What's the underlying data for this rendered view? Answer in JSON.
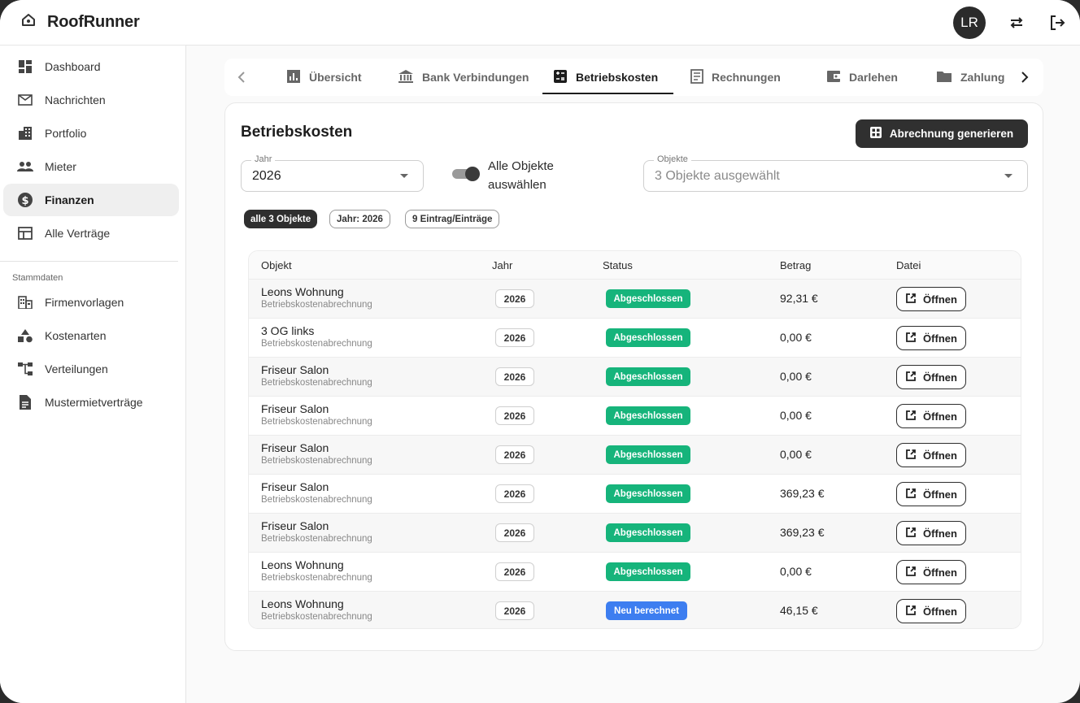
{
  "app": {
    "title": "RoofRunner",
    "logo_icon": "house-icon"
  },
  "header": {
    "avatar_initials": "LR",
    "switch_icon": "swap-arrows-icon",
    "logout_icon": "logout-icon"
  },
  "sidebar": {
    "items": [
      {
        "label": "Dashboard",
        "icon": "dashboard-icon"
      },
      {
        "label": "Nachrichten",
        "icon": "mail-icon"
      },
      {
        "label": "Portfolio",
        "icon": "building-icon"
      },
      {
        "label": "Mieter",
        "icon": "people-icon"
      },
      {
        "label": "Finanzen",
        "icon": "dollar-circle-icon",
        "active": true
      },
      {
        "label": "Alle Verträge",
        "icon": "table-icon"
      }
    ],
    "section_title": "Stammdaten",
    "section_items": [
      {
        "label": "Firmenvorlagen",
        "icon": "company-icon"
      },
      {
        "label": "Kostenarten",
        "icon": "shapes-icon"
      },
      {
        "label": "Verteilungen",
        "icon": "tree-icon"
      },
      {
        "label": "Mustermietverträge",
        "icon": "document-icon"
      }
    ]
  },
  "tabs": [
    {
      "label": "Übersicht",
      "icon": "chart-icon"
    },
    {
      "label": "Bank Verbindungen",
      "icon": "bank-icon"
    },
    {
      "label": "Betriebskosten",
      "icon": "calculator-icon",
      "active": true
    },
    {
      "label": "Rechnungen",
      "icon": "receipt-icon"
    },
    {
      "label": "Darlehen",
      "icon": "wallet-icon"
    },
    {
      "label": "Zahlung",
      "icon": "folder-icon"
    }
  ],
  "main": {
    "title": "Betriebskosten",
    "generate_button": "Abrechnung generieren",
    "year_field": {
      "label": "Jahr",
      "value": "2026"
    },
    "toggle_label": "Alle Objekte auswählen",
    "toggle_on": true,
    "objects_field": {
      "label": "Objekte",
      "value": "3 Objekte ausgewählt"
    },
    "chips": [
      "alle 3 Objekte",
      "Jahr: 2026",
      "9 Eintrag/Einträge"
    ]
  },
  "table": {
    "headers": [
      "Objekt",
      "Jahr",
      "Status",
      "Betrag",
      "Datei"
    ],
    "open_label": "Öffnen",
    "rows": [
      {
        "name": "Leons Wohnung",
        "sub": "Betriebskostenabrechnung",
        "year": "2026",
        "status": "Abgeschlossen",
        "status_type": "done",
        "amount": "92,31 €"
      },
      {
        "name": "3 OG links",
        "sub": "Betriebskostenabrechnung",
        "year": "2026",
        "status": "Abgeschlossen",
        "status_type": "done",
        "amount": "0,00 €"
      },
      {
        "name": "Friseur Salon",
        "sub": "Betriebskostenabrechnung",
        "year": "2026",
        "status": "Abgeschlossen",
        "status_type": "done",
        "amount": "0,00 €"
      },
      {
        "name": "Friseur Salon",
        "sub": "Betriebskostenabrechnung",
        "year": "2026",
        "status": "Abgeschlossen",
        "status_type": "done",
        "amount": "0,00 €"
      },
      {
        "name": "Friseur Salon",
        "sub": "Betriebskostenabrechnung",
        "year": "2026",
        "status": "Abgeschlossen",
        "status_type": "done",
        "amount": "0,00 €"
      },
      {
        "name": "Friseur Salon",
        "sub": "Betriebskostenabrechnung",
        "year": "2026",
        "status": "Abgeschlossen",
        "status_type": "done",
        "amount": "369,23 €"
      },
      {
        "name": "Friseur Salon",
        "sub": "Betriebskostenabrechnung",
        "year": "2026",
        "status": "Abgeschlossen",
        "status_type": "done",
        "amount": "369,23 €"
      },
      {
        "name": "Leons Wohnung",
        "sub": "Betriebskostenabrechnung",
        "year": "2026",
        "status": "Abgeschlossen",
        "status_type": "done",
        "amount": "0,00 €"
      },
      {
        "name": "Leons Wohnung",
        "sub": "Betriebskostenabrechnung",
        "year": "2026",
        "status": "Neu berechnet",
        "status_type": "recalc",
        "amount": "46,15 €"
      }
    ]
  },
  "colors": {
    "status_done": "#16b47b",
    "status_recalc": "#3d7ef0",
    "primary_dark": "#303030"
  }
}
